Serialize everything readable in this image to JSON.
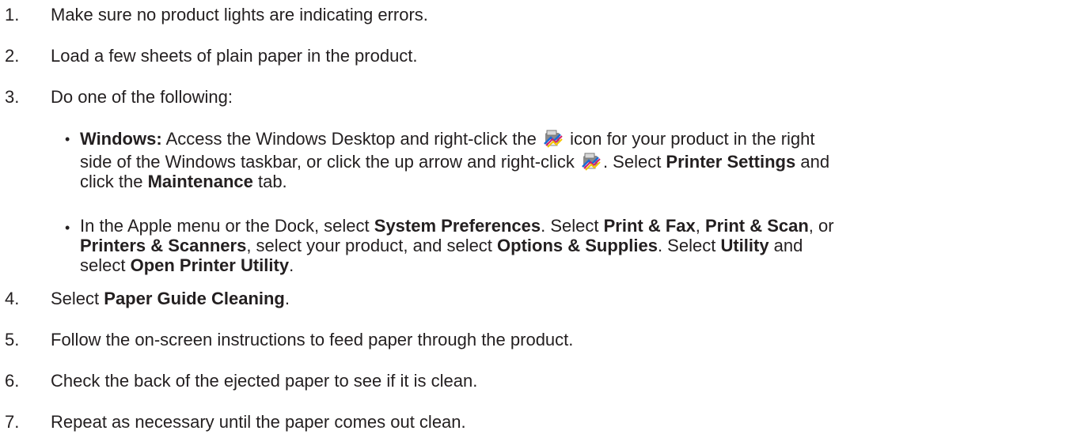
{
  "steps": [
    {
      "num": "1.",
      "text": "Make sure no product lights are indicating errors."
    },
    {
      "num": "2.",
      "text": "Load a few sheets of plain paper in the product."
    },
    {
      "num": "3.",
      "text": "Do one of the following:"
    },
    {
      "num": "4.",
      "pre": "Select ",
      "bold": "Paper Guide Cleaning",
      "post": "."
    },
    {
      "num": "5.",
      "text": "Follow the on-screen instructions to feed paper through the product."
    },
    {
      "num": "6.",
      "text": "Check the back of the ejected paper to see if it is clean."
    },
    {
      "num": "7.",
      "text": "Repeat as necessary until the paper comes out clean."
    }
  ],
  "windows_item": {
    "label": "Windows:",
    "t1": " Access the Windows Desktop and right-click the ",
    "t2": " icon for your product in the right",
    "t3": "side of the Windows taskbar, or click the up arrow and right-click ",
    "t4": ". Select ",
    "b1": "Printer Settings",
    "t5": " and",
    "t6": "click the ",
    "b2": "Maintenance",
    "t7": " tab."
  },
  "mac_item": {
    "t1": "In the Apple menu or the Dock, select ",
    "b1": "System Preferences",
    "t2": ". Select ",
    "b2": "Print & Fax",
    "t3": ", ",
    "b3": "Print & Scan",
    "t4": ", or",
    "b4": "Printers & Scanners",
    "t5": ", select your product, and select ",
    "b5": "Options & Supplies",
    "t6": ". Select ",
    "b6": "Utility",
    "t7": " and",
    "t8": "select ",
    "b7": "Open Printer Utility",
    "t9": "."
  },
  "icons": {
    "taskbar_icon": "epson-printer-status-icon"
  }
}
